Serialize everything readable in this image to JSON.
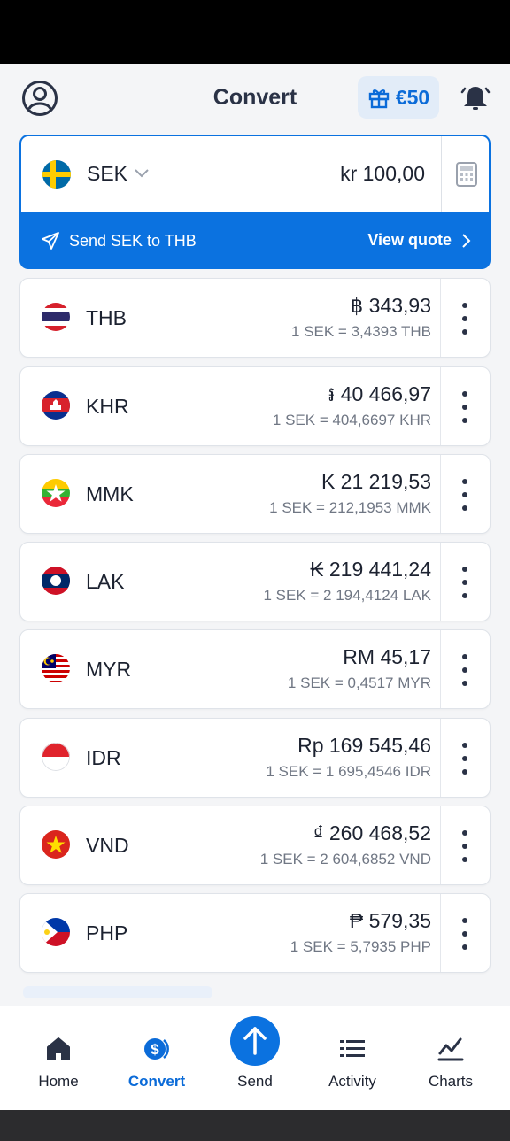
{
  "header": {
    "title": "Convert",
    "reward": "€50"
  },
  "source": {
    "currency": "SEK",
    "amount": "kr 100,00",
    "send_text": "Send SEK to THB",
    "quote_label": "View quote"
  },
  "rows": [
    {
      "code": "THB",
      "amount": "฿ 343,93",
      "rate": "1 SEK = 3,4393 THB",
      "flag": "thailand-flag"
    },
    {
      "code": "KHR",
      "amount": "៛ 40 466,97",
      "rate": "1 SEK = 404,6697 KHR",
      "flag": "cambodia-flag"
    },
    {
      "code": "MMK",
      "amount": "K 21 219,53",
      "rate": "1 SEK = 212,1953 MMK",
      "flag": "myanmar-flag"
    },
    {
      "code": "LAK",
      "amount": "₭ 219 441,24",
      "rate": "1 SEK = 2 194,4124 LAK",
      "flag": "laos-flag"
    },
    {
      "code": "MYR",
      "amount": "RM 45,17",
      "rate": "1 SEK = 0,4517 MYR",
      "flag": "malaysia-flag"
    },
    {
      "code": "IDR",
      "amount": "Rp 169 545,46",
      "rate": "1 SEK = 1 695,4546 IDR",
      "flag": "indonesia-flag"
    },
    {
      "code": "VND",
      "amount": "₫ 260 468,52",
      "rate": "1 SEK = 2 604,6852 VND",
      "flag": "vietnam-flag"
    },
    {
      "code": "PHP",
      "amount": "₱ 579,35",
      "rate": "1 SEK = 5,7935 PHP",
      "flag": "philippines-flag"
    }
  ],
  "nav": {
    "home": "Home",
    "convert": "Convert",
    "send": "Send",
    "activity": "Activity",
    "charts": "Charts"
  },
  "colors": {
    "accent": "#0b72e0",
    "text": "#1c2230",
    "muted": "#707784"
  }
}
